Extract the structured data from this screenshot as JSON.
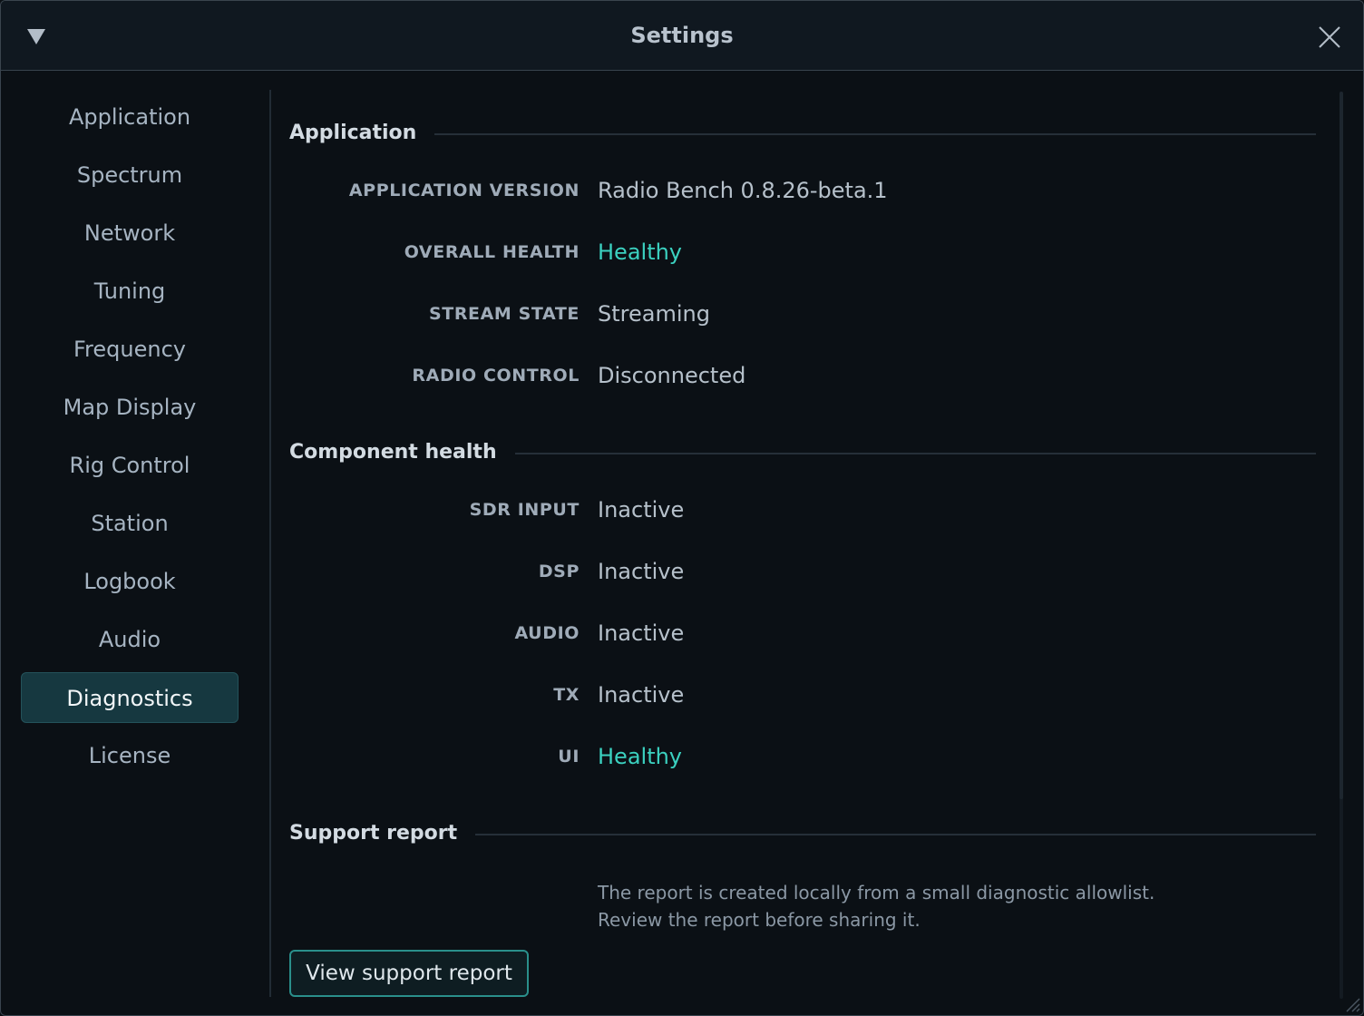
{
  "window": {
    "title": "Settings"
  },
  "sidebar": {
    "items": [
      {
        "label": "Application"
      },
      {
        "label": "Spectrum"
      },
      {
        "label": "Network"
      },
      {
        "label": "Tuning"
      },
      {
        "label": "Frequency"
      },
      {
        "label": "Map Display"
      },
      {
        "label": "Rig Control"
      },
      {
        "label": "Station"
      },
      {
        "label": "Logbook"
      },
      {
        "label": "Audio"
      },
      {
        "label": "Diagnostics",
        "active": true
      },
      {
        "label": "License"
      }
    ]
  },
  "application_section": {
    "title": "Application",
    "rows": [
      {
        "label": "APPLICATION VERSION",
        "value": "Radio Bench 0.8.26-beta.1"
      },
      {
        "label": "OVERALL HEALTH",
        "value": "Healthy",
        "status": "healthy"
      },
      {
        "label": "STREAM STATE",
        "value": "Streaming"
      },
      {
        "label": "RADIO CONTROL",
        "value": "Disconnected"
      }
    ]
  },
  "component_section": {
    "title": "Component health",
    "rows": [
      {
        "label": "SDR INPUT",
        "value": "Inactive"
      },
      {
        "label": "DSP",
        "value": "Inactive"
      },
      {
        "label": "AUDIO",
        "value": "Inactive"
      },
      {
        "label": "TX",
        "value": "Inactive"
      },
      {
        "label": "UI",
        "value": "Healthy",
        "status": "healthy"
      }
    ]
  },
  "support_section": {
    "title": "Support report",
    "note_line1": "The report is created locally from a small diagnostic allowlist.",
    "note_line2": "Review the report before sharing it.",
    "button_label": "View support report"
  },
  "colors": {
    "accent": "#3bd1c0",
    "active_nav_bg": "#163840",
    "background": "#0b1015"
  }
}
